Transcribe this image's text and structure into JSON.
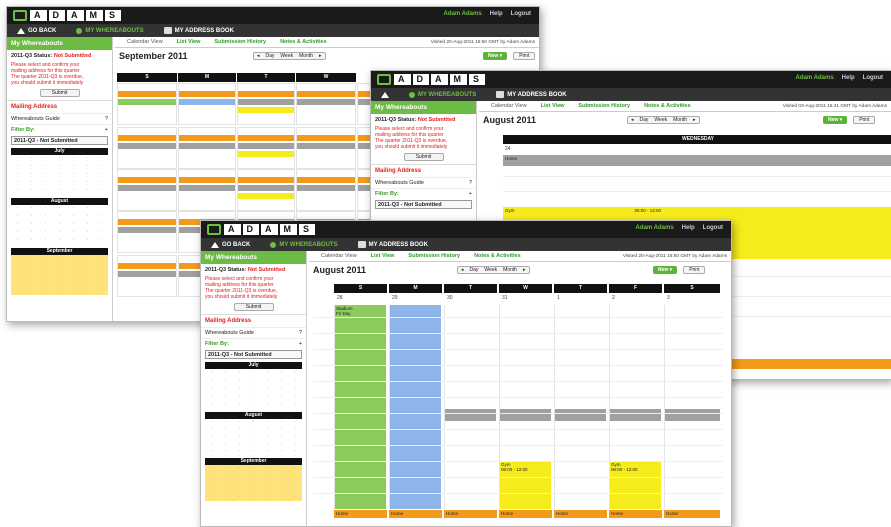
{
  "common": {
    "logo": [
      "A",
      "D",
      "A",
      "M",
      "S"
    ],
    "user": "Adam Adams",
    "help": "Help",
    "logout": "Logout",
    "nav_back": "GO BACK",
    "nav_where": "MY WHEREABOUTS",
    "nav_addr": "MY ADDRESS BOOK",
    "side_title": "My Whereabouts",
    "status_label": "2011-Q3 Status:",
    "status_value": "Not Submitted",
    "warn1": "Please select and confirm your",
    "warn2": "mailing address for this quarter",
    "warn3": "The quarter 2011-Q3 is overdue,",
    "warn4": "you should submit it immediately",
    "submit": "Submit",
    "mailing": "Mailing Address",
    "guide": "Whereabouts Guide",
    "filter": "Filter By:",
    "filter_value": "2011-Q3 - Not Submitted",
    "tab_cal": "Calendar View",
    "tab_list": "List View",
    "tab_hist": "Submission History",
    "tab_notes": "Notes & Activities",
    "btn_day": "Day",
    "btn_week": "Week",
    "btn_month": "Month",
    "btn_new": "New",
    "btn_print": "Print",
    "july": "July",
    "august": "August",
    "september": "September"
  },
  "w1": {
    "visited": "Visited 20-Aug-2011 16:50 GMT by Adam Adams",
    "title": "September 2011",
    "days": [
      "S",
      "M",
      "T",
      "W"
    ]
  },
  "w2": {
    "visited": "Visited 03-Aug-2011 15:41 GMT by Adam Adams",
    "title": "August 2011",
    "day_header": "WEDNESDAY",
    "date": "24",
    "ev_home": "Home",
    "ev_gym": "Gym",
    "ev_gym_time": "06:00 - 12:00"
  },
  "w3": {
    "visited": "Visited 20-Aug-2011 16:50 GMT by Adam Adams",
    "title": "August 2011",
    "days": [
      "S",
      "M",
      "T",
      "W",
      "T",
      "F",
      "S"
    ],
    "dates": [
      "28",
      "29",
      "30",
      "31",
      "1",
      "2",
      "3"
    ],
    "ev_stadium": "Stadium",
    "ev_stadium2": "Fri Day",
    "ev_gym": "Gym",
    "ev_gym_time": "06:00 - 12:00",
    "ev_home": "Home"
  }
}
